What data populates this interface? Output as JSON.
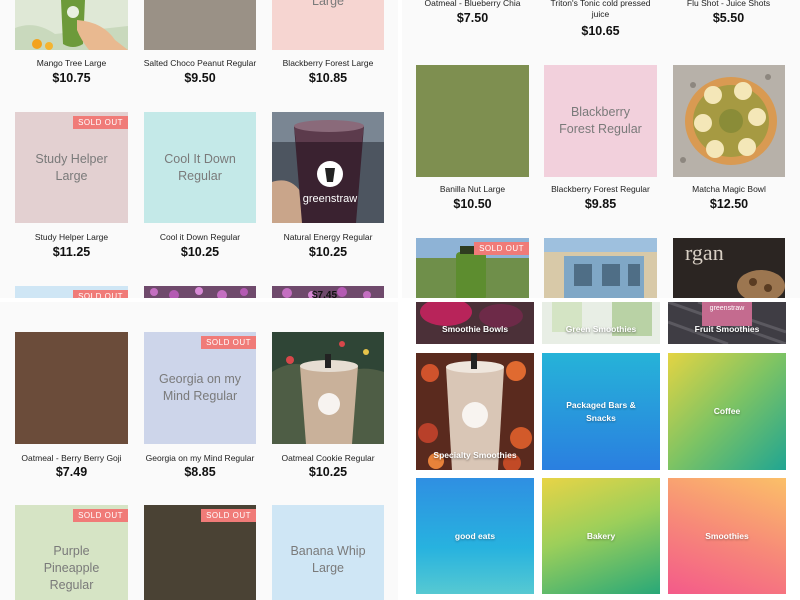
{
  "panes": {
    "top_left": {
      "products": [
        {
          "name": "Mango Tree Large",
          "price": "$10.75",
          "sold_out": false,
          "placeholder": ""
        },
        {
          "name": "Salted Choco Peanut Regular",
          "price": "$9.50",
          "sold_out": false,
          "placeholder": ""
        },
        {
          "name": "Blackberry Forest Large",
          "price": "$10.85",
          "sold_out": false,
          "placeholder": "Large"
        },
        {
          "name": "Study Helper Large",
          "price": "$11.25",
          "sold_out": true,
          "placeholder": "Study Helper Large"
        },
        {
          "name": "Cool it Down Regular",
          "price": "$10.25",
          "sold_out": false,
          "placeholder": "Cool It Down Regular"
        },
        {
          "name": "Natural Energy Regular",
          "price": "$10.25",
          "sold_out": false,
          "placeholder": ""
        }
      ],
      "row3_sold_out": true,
      "row3_price_partial": "$7.45"
    },
    "top_right": {
      "top_row": [
        {
          "name": "Oatmeal - Blueberry Chia",
          "price": "$7.50"
        },
        {
          "name": "Triton's Tonic cold pressed juice",
          "price": "$10.65"
        },
        {
          "name": "Flu Shot - Juice Shots",
          "price": "$5.50"
        }
      ],
      "products": [
        {
          "name": "Banilla Nut Large",
          "price": "$10.50",
          "sold_out": false,
          "placeholder": ""
        },
        {
          "name": "Blackberry Forest Regular",
          "price": "$9.85",
          "sold_out": false,
          "placeholder": "Blackberry Forest Regular"
        },
        {
          "name": "Matcha Magic Bowl",
          "price": "$12.50",
          "sold_out": false,
          "placeholder": ""
        }
      ],
      "row3_sold_out": true,
      "row3_sign_text": "rgan"
    },
    "bottom_left": {
      "products": [
        {
          "name": "Oatmeal - Berry Berry Goji",
          "price": "$7.49",
          "sold_out": false,
          "placeholder": ""
        },
        {
          "name": "Georgia on my Mind Regular",
          "price": "$8.85",
          "sold_out": true,
          "placeholder": "Georgia on my Mind Regular"
        },
        {
          "name": "Oatmeal Cookie Regular",
          "price": "$10.25",
          "sold_out": false,
          "placeholder": ""
        },
        {
          "name": "Purple Pineapple Regular",
          "price": "",
          "sold_out": true,
          "placeholder": "Purple Pineapple Regular"
        },
        {
          "name": "",
          "price": "",
          "sold_out": true,
          "placeholder": ""
        },
        {
          "name": "Banana Whip Large",
          "price": "",
          "sold_out": false,
          "placeholder": "Banana Whip Large"
        }
      ]
    },
    "bottom_right": {
      "categories": [
        {
          "label": "Smoothie Bowls"
        },
        {
          "label": "Green Smoothies"
        },
        {
          "label": "Fruit Smoothies"
        },
        {
          "label": "Specialty Smoothies"
        },
        {
          "label": "Packaged Bars & Snacks"
        },
        {
          "label": "Coffee"
        },
        {
          "label": "good eats"
        },
        {
          "label": "Bakery"
        },
        {
          "label": "Smoothies"
        }
      ]
    }
  },
  "sold_out_label": "SOLD OUT",
  "colors": {
    "sold_out_badge": "#f07b78",
    "placeholder_pink": "#f6d5d1",
    "placeholder_mauve": "#e3d0d1",
    "placeholder_teal": "#c4e9e8",
    "placeholder_sage": "#7e8f50",
    "placeholder_blush": "#f2d0dc",
    "placeholder_brown": "#6b4c3a",
    "placeholder_lavender": "#cdd5ea",
    "placeholder_green": "#d6e4c5",
    "placeholder_dark": "#4a4234",
    "placeholder_sky": "#cfe6f5"
  },
  "brand_text": "greenstraw"
}
